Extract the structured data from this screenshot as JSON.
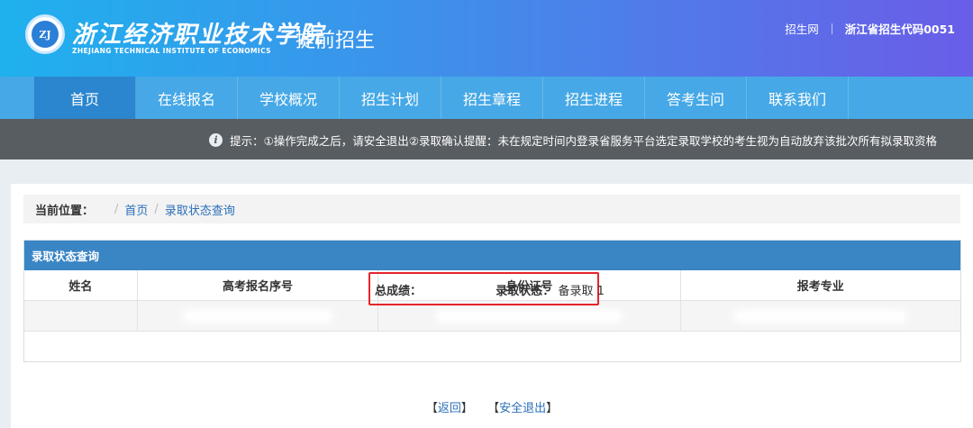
{
  "header": {
    "school_name": "浙江经济职业技术学院",
    "subtitle": "提前招生",
    "school_name_en": "ZHEJIANG TECHNICAL INSTITUTE OF ECONOMICS",
    "logo_text": "ZJ",
    "links": {
      "site": "招生网",
      "code": "浙江省招生代码0051"
    }
  },
  "nav": {
    "items": [
      "首页",
      "在线报名",
      "学校概况",
      "招生计划",
      "招生章程",
      "招生进程",
      "答考生问",
      "联系我们"
    ],
    "active": "首页"
  },
  "notice": {
    "icon": "info-icon",
    "text": "提示：①操作完成之后，请安全退出②录取确认提醒：未在规定时间内登录省服务平台选定录取学校的考生视为自动放弃该批次所有拟录取资格"
  },
  "breadcrumb": {
    "label": "当前位置：",
    "items": [
      "首页",
      "录取状态查询"
    ]
  },
  "panel": {
    "title": "录取状态查询",
    "columns": [
      "姓名",
      "高考报名序号",
      "身份证号",
      "报考专业"
    ],
    "total": {
      "label": "总成绩：",
      "value": "",
      "status_label": "录取状态：",
      "status_value": "备录取 1"
    }
  },
  "actions": {
    "back": "返回",
    "logout": "安全退出"
  },
  "colors": {
    "highlight": "#e5252a",
    "panel_head": "#3a85c4",
    "nav": "#46a8e6",
    "link": "#2a6fb8"
  }
}
